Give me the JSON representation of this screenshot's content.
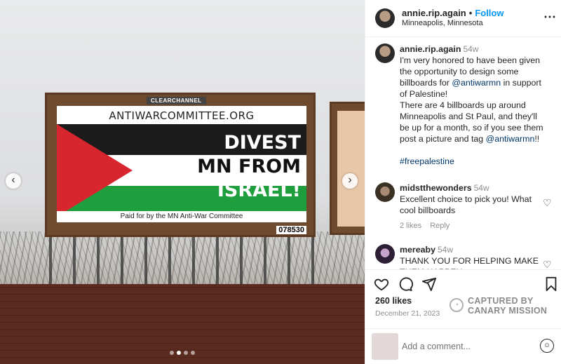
{
  "post": {
    "billboard": {
      "brand": "CLEARCHANNEL",
      "url": "ANTIWARCOMMITTEE.ORG",
      "slogan_lines": [
        "DIVEST",
        "MN FROM",
        "ISRAEL!"
      ],
      "paid_for": "Paid for by the MN Anti-War Committee",
      "panel_number": "078530"
    },
    "carousel": {
      "prev_icon": "chevron-left-icon",
      "next_icon": "chevron-right-icon",
      "slide_count": 4,
      "active_index": 1
    }
  },
  "header": {
    "username": "annie.rip.again",
    "separator": "•",
    "follow_label": "Follow",
    "location": "Minneapolis, Minnesota",
    "more_label": "⋯"
  },
  "caption": {
    "username": "annie.rip.again",
    "time": "54w",
    "text_part1": "I'm very honored to have been given the opportunity to design some billboards for ",
    "mention1": "@antiwarmn",
    "text_part2": " in support of Palestine!",
    "text_part3": "There are 4 billboards up around Minneapolis and St Paul, and they'll be up for a month, so if you see them post a picture and tag ",
    "mention2": "@antiwarmn",
    "text_part4": "!!",
    "hashtag": "#freepalestine"
  },
  "comments": [
    {
      "username": "midstthewonders",
      "time": "54w",
      "text": "Excellent choice to pick you! What cool billboards",
      "likes": "2 likes",
      "reply_label": "Reply"
    },
    {
      "username": "mereaby",
      "time": "54w",
      "text": "THANK YOU FOR HELPING MAKE THEM HAPPEN"
    }
  ],
  "actions": {
    "like_icon": "heart-icon",
    "comment_icon": "comment-icon",
    "share_icon": "share-icon",
    "save_icon": "bookmark-icon"
  },
  "stats": {
    "likes": "260 likes",
    "date": "December 21, 2023"
  },
  "watermark": {
    "line1": "CAPTURED BY",
    "line2": "CANARY MISSION"
  },
  "composer": {
    "placeholder": "Add a comment...",
    "emoji_icon": "emoji-icon"
  },
  "colors": {
    "link_blue": "#0095f6",
    "mention_blue": "#00376b",
    "muted": "#8e8e8e",
    "flag_red": "#d8262e",
    "flag_green": "#1f9e3e"
  }
}
